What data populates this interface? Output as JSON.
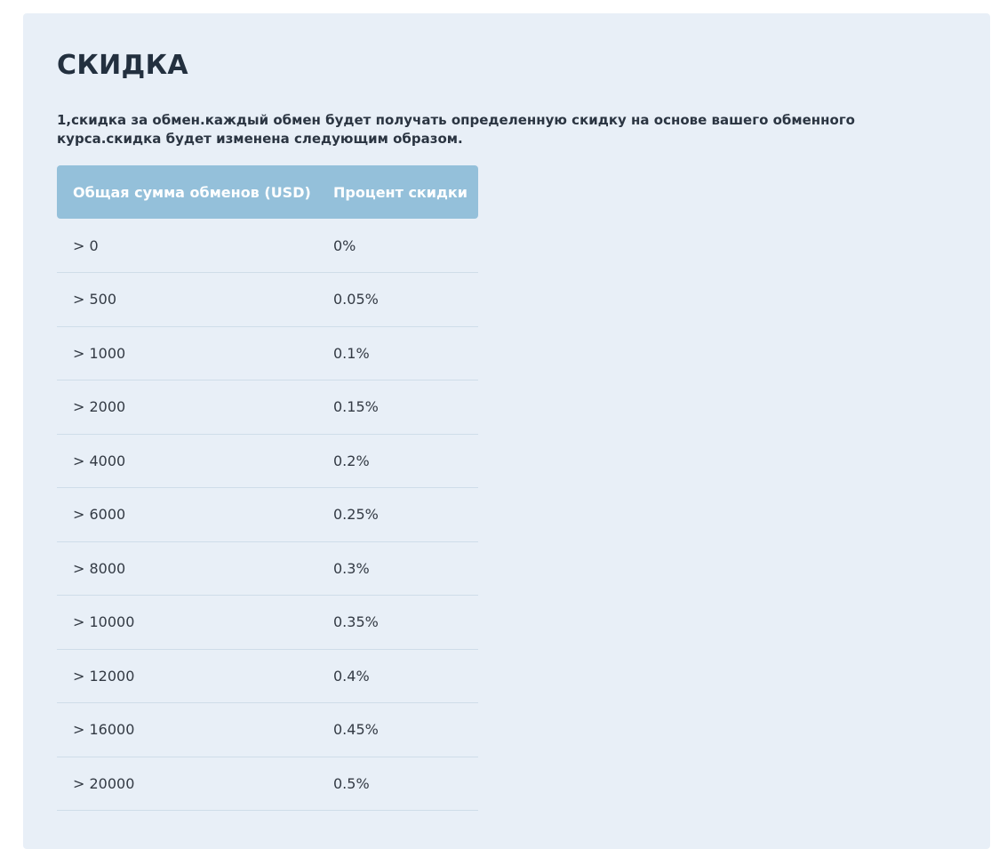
{
  "section": {
    "title": "СКИДКА",
    "description": "1,скидка за обмен.каждый обмен будет получать определенную скидку на основе вашего обменного курса.скидка будет изменена следующим образом."
  },
  "table": {
    "headers": [
      "Общая сумма обменов (USD)",
      "Процент скидки"
    ],
    "rows": [
      {
        "amount": "> 0",
        "discount": "0%"
      },
      {
        "amount": "> 500",
        "discount": "0.05%"
      },
      {
        "amount": "> 1000",
        "discount": "0.1%"
      },
      {
        "amount": "> 2000",
        "discount": "0.15%"
      },
      {
        "amount": "> 4000",
        "discount": "0.2%"
      },
      {
        "amount": "> 6000",
        "discount": "0.25%"
      },
      {
        "amount": "> 8000",
        "discount": "0.3%"
      },
      {
        "amount": "> 10000",
        "discount": "0.35%"
      },
      {
        "amount": "> 12000",
        "discount": "0.4%"
      },
      {
        "amount": "> 16000",
        "discount": "0.45%"
      },
      {
        "amount": "> 20000",
        "discount": "0.5%"
      }
    ]
  },
  "colors": {
    "panel_background": "#e8eff7",
    "header_background": "#94c0da",
    "title_text": "#23303f",
    "row_divider": "#cfdde9"
  }
}
